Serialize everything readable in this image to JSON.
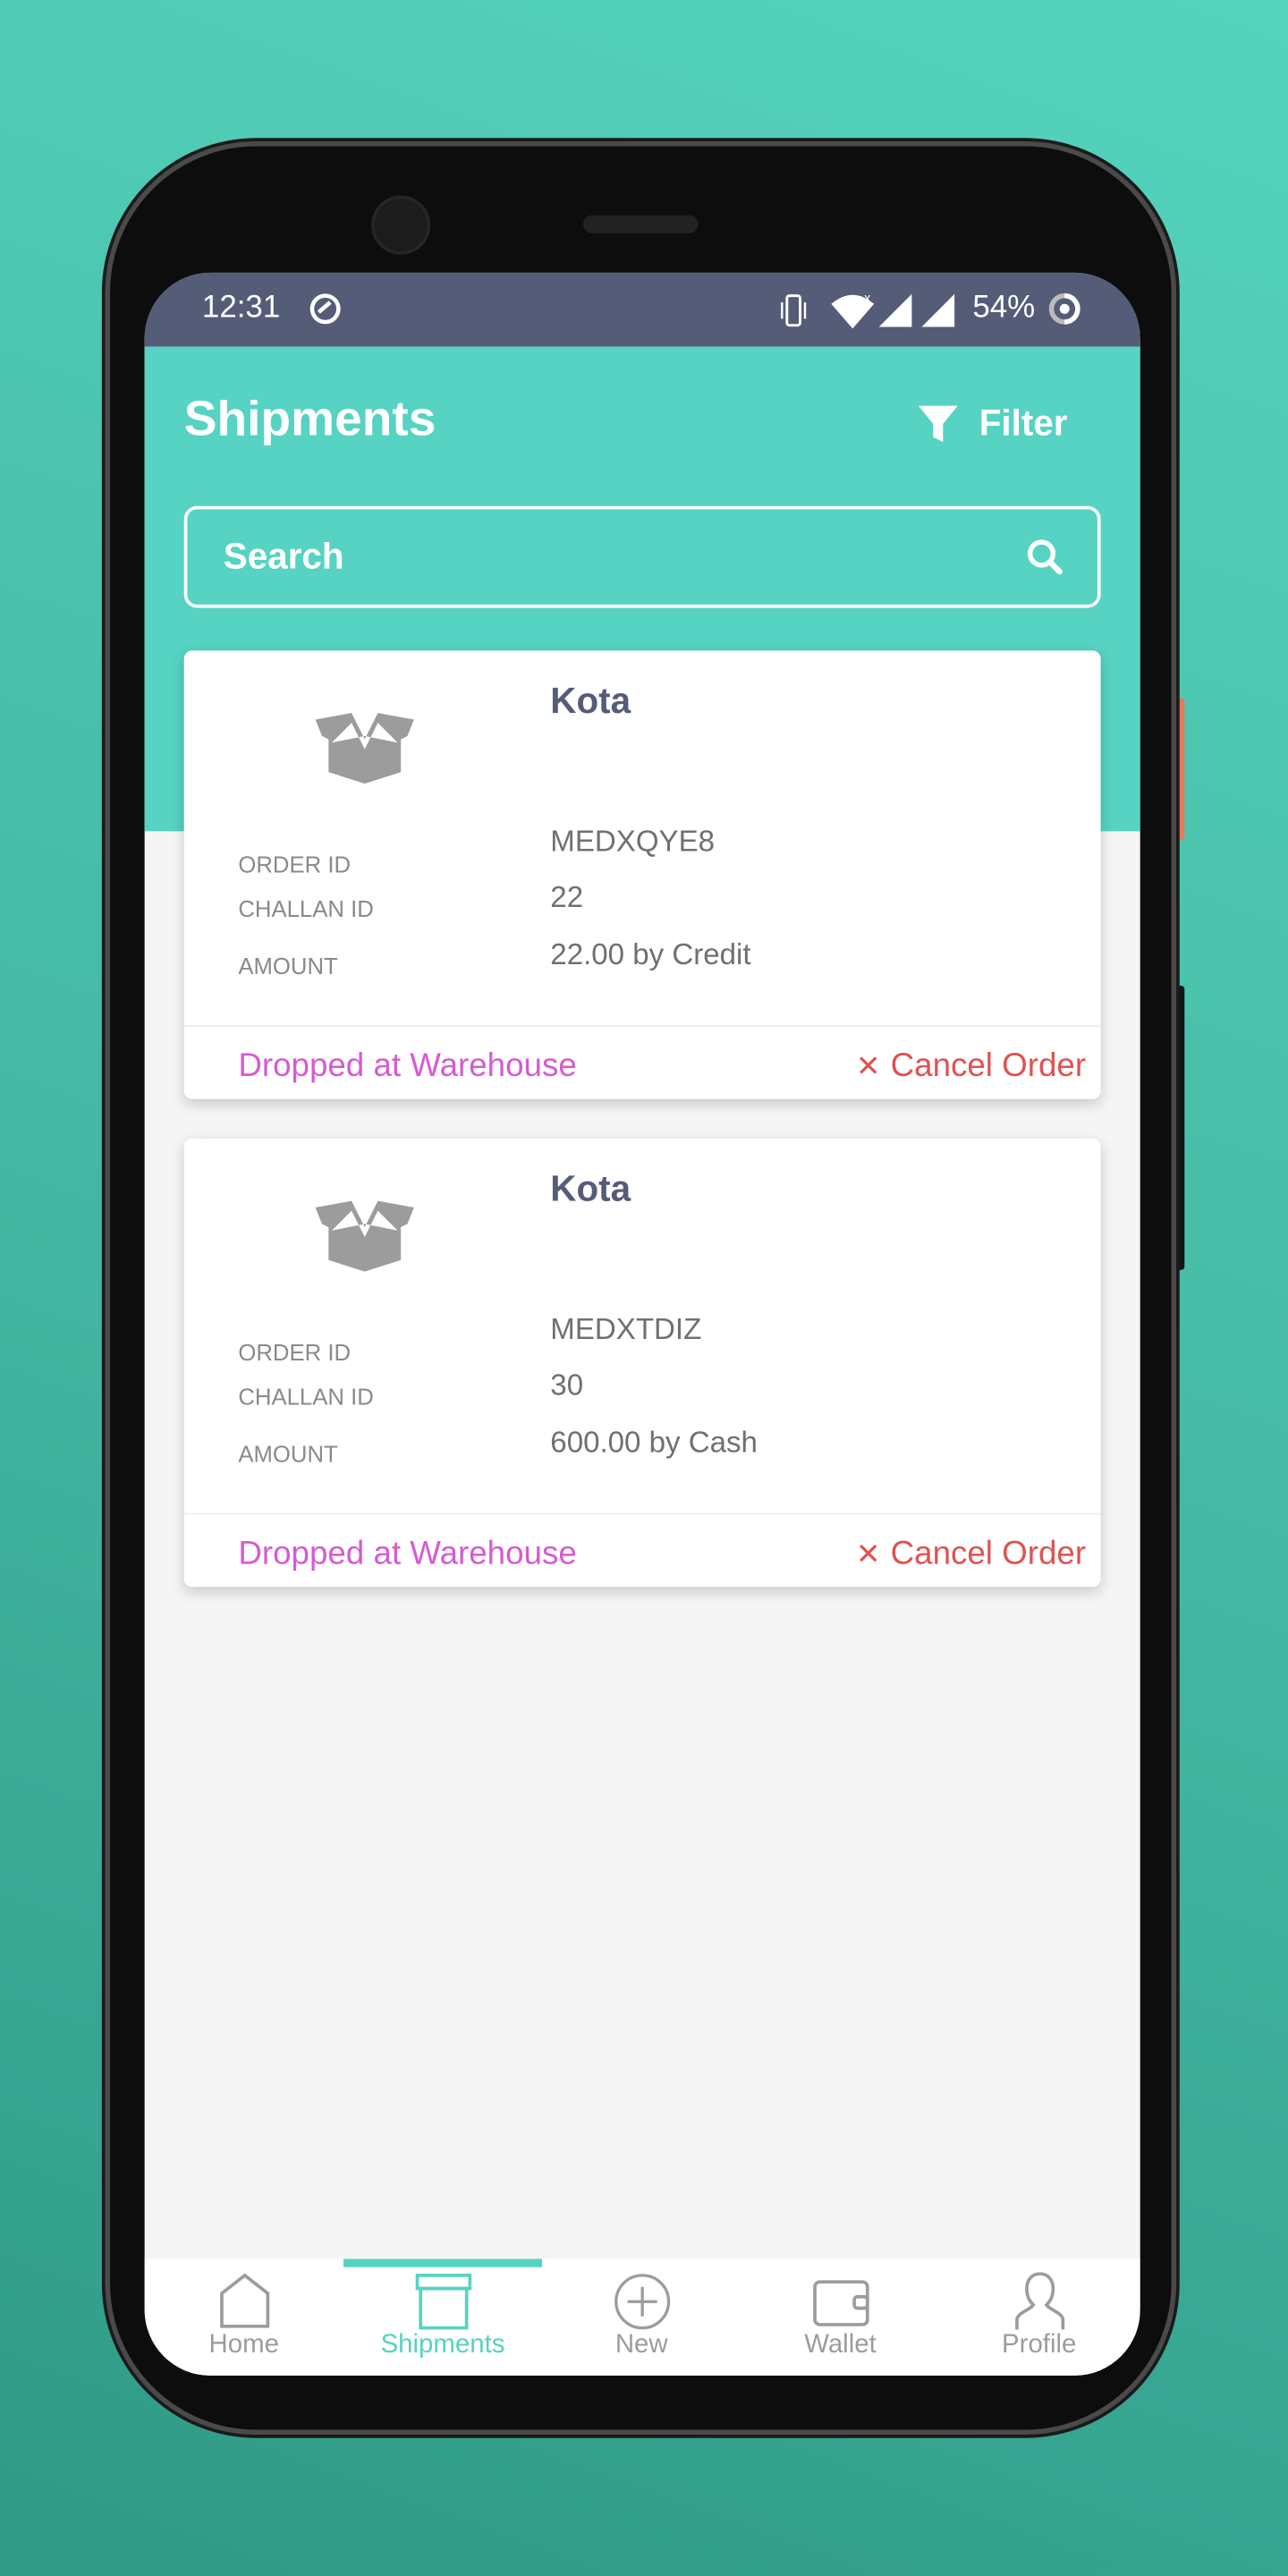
{
  "status_bar": {
    "time": "12:31",
    "battery": "54%"
  },
  "header": {
    "title": "Shipments",
    "filter_label": "Filter"
  },
  "search": {
    "placeholder": "Search"
  },
  "labels": {
    "order_id": "ORDER ID",
    "challan_id": "CHALLAN ID",
    "amount": "AMOUNT",
    "cancel": "Cancel Order"
  },
  "shipments": [
    {
      "city": "Kota",
      "order_id": "MEDXQYE8",
      "challan_id": "22",
      "amount": "22.00 by Credit",
      "status": "Dropped at Warehouse"
    },
    {
      "city": "Kota",
      "order_id": "MEDXTDIZ",
      "challan_id": "30",
      "amount": "600.00 by Cash",
      "status": "Dropped at Warehouse"
    }
  ],
  "nav": {
    "items": [
      {
        "label": "Home",
        "icon": "home-icon"
      },
      {
        "label": "Shipments",
        "icon": "box-icon",
        "active": true
      },
      {
        "label": "New",
        "icon": "plus-circle-icon"
      },
      {
        "label": "Wallet",
        "icon": "wallet-icon"
      },
      {
        "label": "Profile",
        "icon": "person-icon"
      }
    ]
  },
  "colors": {
    "accent": "#56d3c2",
    "status_bar": "#545c78",
    "status_text": "#d65bd0",
    "cancel": "#e05252"
  }
}
